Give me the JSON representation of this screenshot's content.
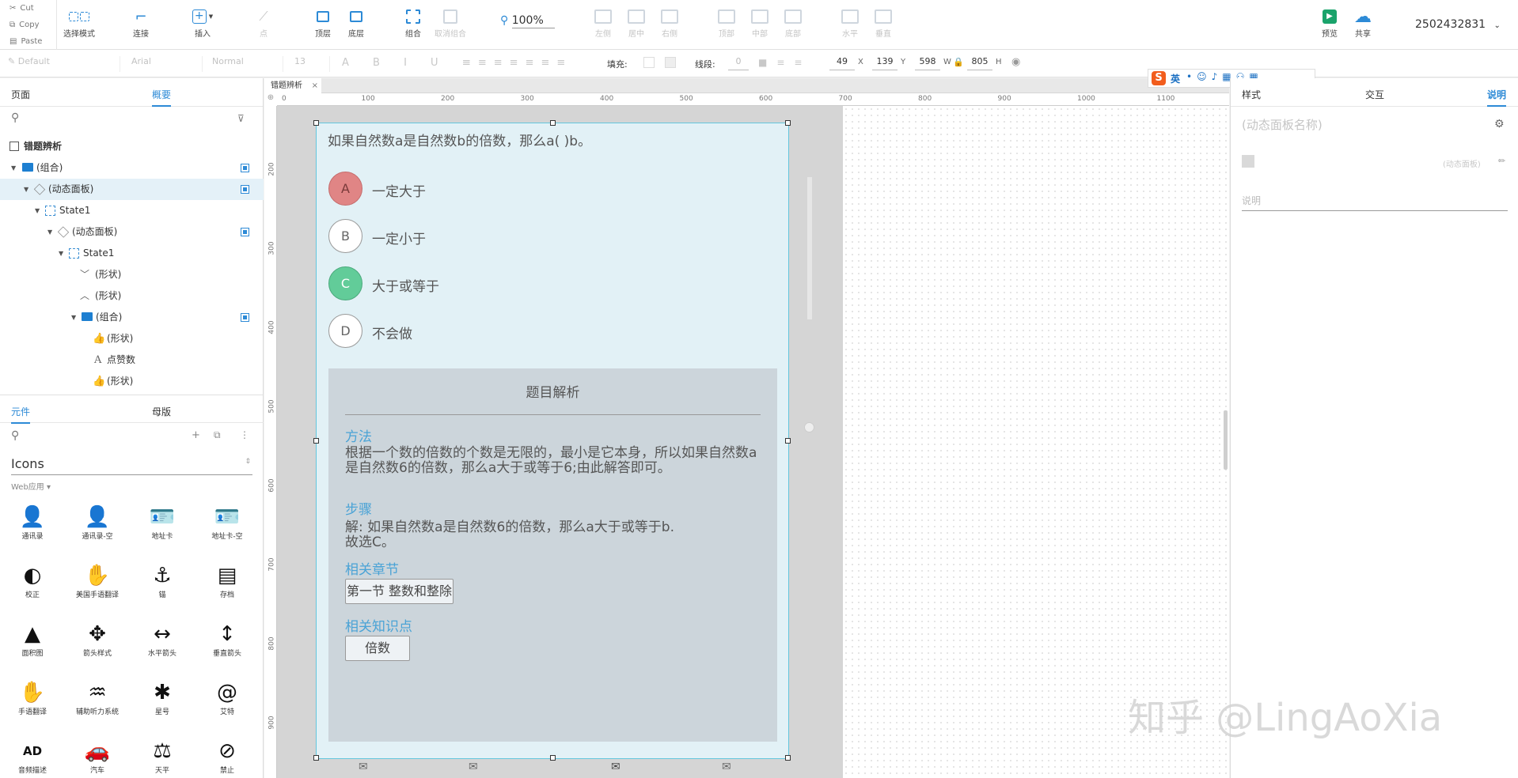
{
  "clipboard": {
    "cut": "Cut",
    "copy": "Copy",
    "paste": "Paste"
  },
  "toolbar": {
    "select_mode": "选择模式",
    "connect": "连接",
    "insert": "插入",
    "point": "点",
    "top": "顶层",
    "bottom": "底层",
    "group": "组合",
    "ungroup": "取消组合",
    "zoom": "100%",
    "align_left": "左侧",
    "align_center": "居中",
    "align_right": "右侧",
    "align_top": "顶部",
    "align_middle": "中部",
    "align_bottom": "底部",
    "dist_h": "水平",
    "dist_v": "垂直",
    "preview": "预览",
    "share": "共享",
    "account": "2502432831"
  },
  "format": {
    "style": "Default",
    "font": "Arial",
    "weight": "Normal",
    "size": "13",
    "fill_label": "填充:",
    "line_label": "线段:",
    "line_val": "0",
    "x": "49",
    "x_label": "X",
    "y": "139",
    "y_label": "Y",
    "w": "598",
    "w_label": "W",
    "h": "805",
    "h_label": "H"
  },
  "left": {
    "tab_pages": "页面",
    "tab_outline": "概要",
    "tree": [
      {
        "label": "错题辨析",
        "bold": true
      },
      {
        "label": "(组合)"
      },
      {
        "label": "(动态面板)"
      },
      {
        "label": "State1"
      },
      {
        "label": "(动态面板)"
      },
      {
        "label": "State1"
      },
      {
        "label": "(形状)"
      },
      {
        "label": "(形状)"
      },
      {
        "label": "(组合)"
      },
      {
        "label": "(形状)"
      },
      {
        "label": "点赞数"
      },
      {
        "label": "(形状)"
      }
    ],
    "lib_tab_widgets": "元件",
    "lib_tab_masters": "母版",
    "lib_name": "Icons",
    "lib_group": "Web应用",
    "icons": [
      {
        "label": "通讯录",
        "glyph": "👤"
      },
      {
        "label": "通讯录-空",
        "glyph": "👤"
      },
      {
        "label": "地址卡",
        "glyph": "🪪"
      },
      {
        "label": "地址卡-空",
        "glyph": "🪪"
      },
      {
        "label": "校正",
        "glyph": "◐"
      },
      {
        "label": "美国手语翻译",
        "glyph": "✋"
      },
      {
        "label": "锚",
        "glyph": "⚓"
      },
      {
        "label": "存档",
        "glyph": "▤"
      },
      {
        "label": "面积图",
        "glyph": "▲"
      },
      {
        "label": "箭头样式",
        "glyph": "✥"
      },
      {
        "label": "水平箭头",
        "glyph": "↔"
      },
      {
        "label": "垂直箭头",
        "glyph": "↕"
      },
      {
        "label": "手语翻译",
        "glyph": "✋"
      },
      {
        "label": "辅助听力系统",
        "glyph": "♒"
      },
      {
        "label": "星号",
        "glyph": "✱"
      },
      {
        "label": "艾特",
        "glyph": "@"
      },
      {
        "label": "音频描述",
        "glyph": "AD"
      },
      {
        "label": "汽车",
        "glyph": "🚗"
      },
      {
        "label": "天平",
        "glyph": "⚖"
      },
      {
        "label": "禁止",
        "glyph": "⊘"
      }
    ]
  },
  "canvas": {
    "tab": "错题辨析",
    "ruler_h": [
      "0",
      "100",
      "200",
      "300",
      "400",
      "500",
      "600",
      "700",
      "800",
      "900",
      "1000",
      "1100"
    ],
    "ruler_v": [
      "200",
      "300",
      "400",
      "500",
      "600",
      "700",
      "800",
      "900"
    ],
    "question": "如果自然数a是自然数b的倍数，那么a(        )b。",
    "options": [
      {
        "letter": "A",
        "text": "一定大于",
        "state": "wrong"
      },
      {
        "letter": "B",
        "text": "一定小于",
        "state": "normal"
      },
      {
        "letter": "C",
        "text": "大于或等于",
        "state": "correct"
      },
      {
        "letter": "D",
        "text": "不会做",
        "state": "normal"
      }
    ],
    "colors": {
      "wrong": "#e08585",
      "correct": "#62cc99"
    },
    "analysis": {
      "title": "题目解析",
      "method_label": "方法",
      "method_text": "根据一个数的倍数的个数是无限的，最小是它本身，所以如果自然数a是自然数6的倍数，那么a大于或等于6;由此解答即可。",
      "steps_label": "步骤",
      "steps_text": "解: 如果自然数a是自然数6的倍数，那么a大于或等于b.\n故选C。",
      "chapter_label": "相关章节",
      "chapter_chip": "第一节 整数和整除",
      "knowledge_label": "相关知识点",
      "knowledge_chip": "倍数"
    }
  },
  "right": {
    "tab_style": "样式",
    "tab_interact": "交互",
    "tab_notes": "说明",
    "name_placeholder": "(动态面板名称)",
    "type_hint": "(动态面板)",
    "notes_placeholder": "说明"
  },
  "ime": {
    "lang": "英"
  },
  "watermark": "知乎 @LingAoXia"
}
